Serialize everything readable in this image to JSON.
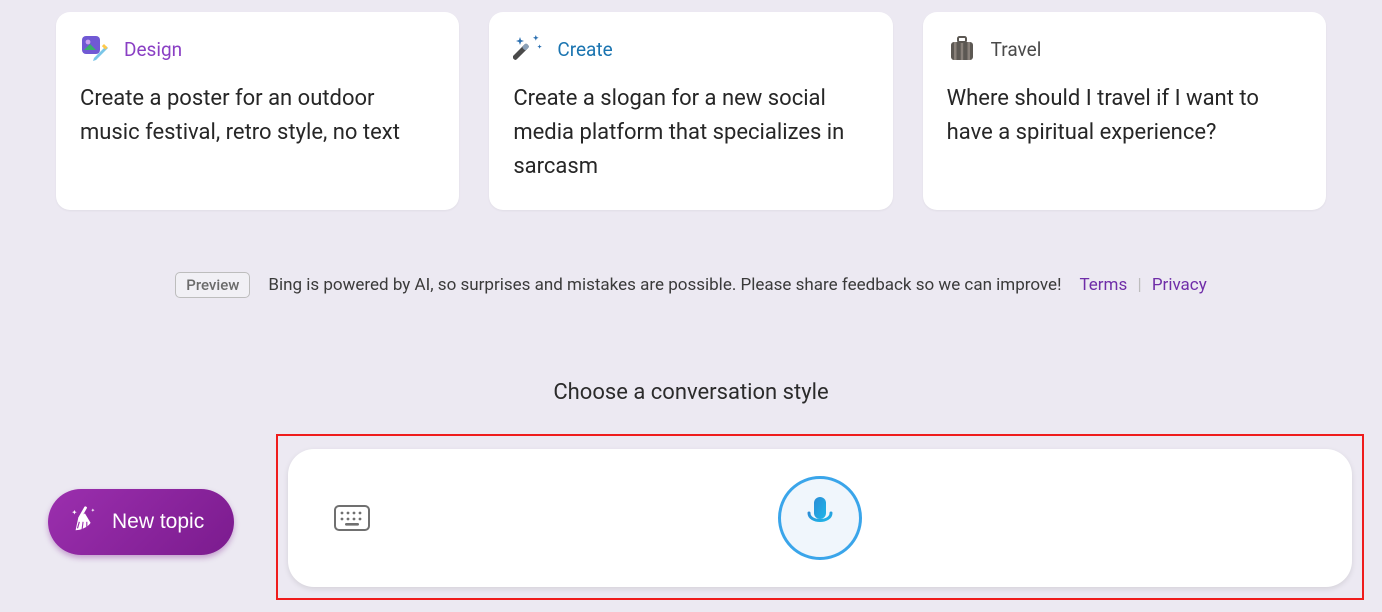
{
  "cards": [
    {
      "category": "Design",
      "prompt": "Create a poster for an outdoor music festival, retro style, no text"
    },
    {
      "category": "Create",
      "prompt": "Create a slogan for a new social media platform that specializes in sarcasm"
    },
    {
      "category": "Travel",
      "prompt": "Where should I travel if I want to have a spiritual experience?"
    }
  ],
  "disclaimer": {
    "badge": "Preview",
    "text": "Bing is powered by AI, so surprises and mistakes are possible. Please share feedback so we can improve!",
    "terms": "Terms",
    "privacy": "Privacy"
  },
  "style_heading": "Choose a conversation style",
  "new_topic": "New topic"
}
